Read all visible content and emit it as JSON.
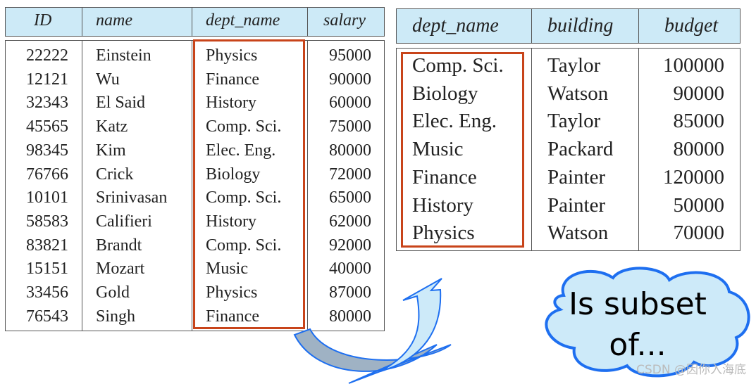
{
  "instructor": {
    "headers": [
      "ID",
      "name",
      "dept_name",
      "salary"
    ],
    "rows": [
      [
        "22222",
        "Einstein",
        "Physics",
        "95000"
      ],
      [
        "12121",
        "Wu",
        "Finance",
        "90000"
      ],
      [
        "32343",
        "El Said",
        "History",
        "60000"
      ],
      [
        "45565",
        "Katz",
        "Comp. Sci.",
        "75000"
      ],
      [
        "98345",
        "Kim",
        "Elec. Eng.",
        "80000"
      ],
      [
        "76766",
        "Crick",
        "Biology",
        "72000"
      ],
      [
        "10101",
        "Srinivasan",
        "Comp. Sci.",
        "65000"
      ],
      [
        "58583",
        "Califieri",
        "History",
        "62000"
      ],
      [
        "83821",
        "Brandt",
        "Comp. Sci.",
        "92000"
      ],
      [
        "15151",
        "Mozart",
        "Music",
        "40000"
      ],
      [
        "33456",
        "Gold",
        "Physics",
        "87000"
      ],
      [
        "76543",
        "Singh",
        "Finance",
        "80000"
      ]
    ]
  },
  "department": {
    "headers": [
      "dept_name",
      "building",
      "budget"
    ],
    "rows": [
      [
        "Comp. Sci.",
        "Taylor",
        "100000"
      ],
      [
        "Biology",
        "Watson",
        "90000"
      ],
      [
        "Elec. Eng.",
        "Taylor",
        "85000"
      ],
      [
        "Music",
        "Packard",
        "80000"
      ],
      [
        "Finance",
        "Painter",
        "120000"
      ],
      [
        "History",
        "Painter",
        "50000"
      ],
      [
        "Physics",
        "Watson",
        "70000"
      ]
    ]
  },
  "callout": {
    "line1": "Is subset",
    "line2": "of..."
  },
  "watermark": "CSDN @因你入海底",
  "colors": {
    "header_bg": "#cdeaf7",
    "highlight": "#c8441a",
    "cloud_fill": "#cdeaf9",
    "cloud_stroke": "#1e6ff0"
  }
}
